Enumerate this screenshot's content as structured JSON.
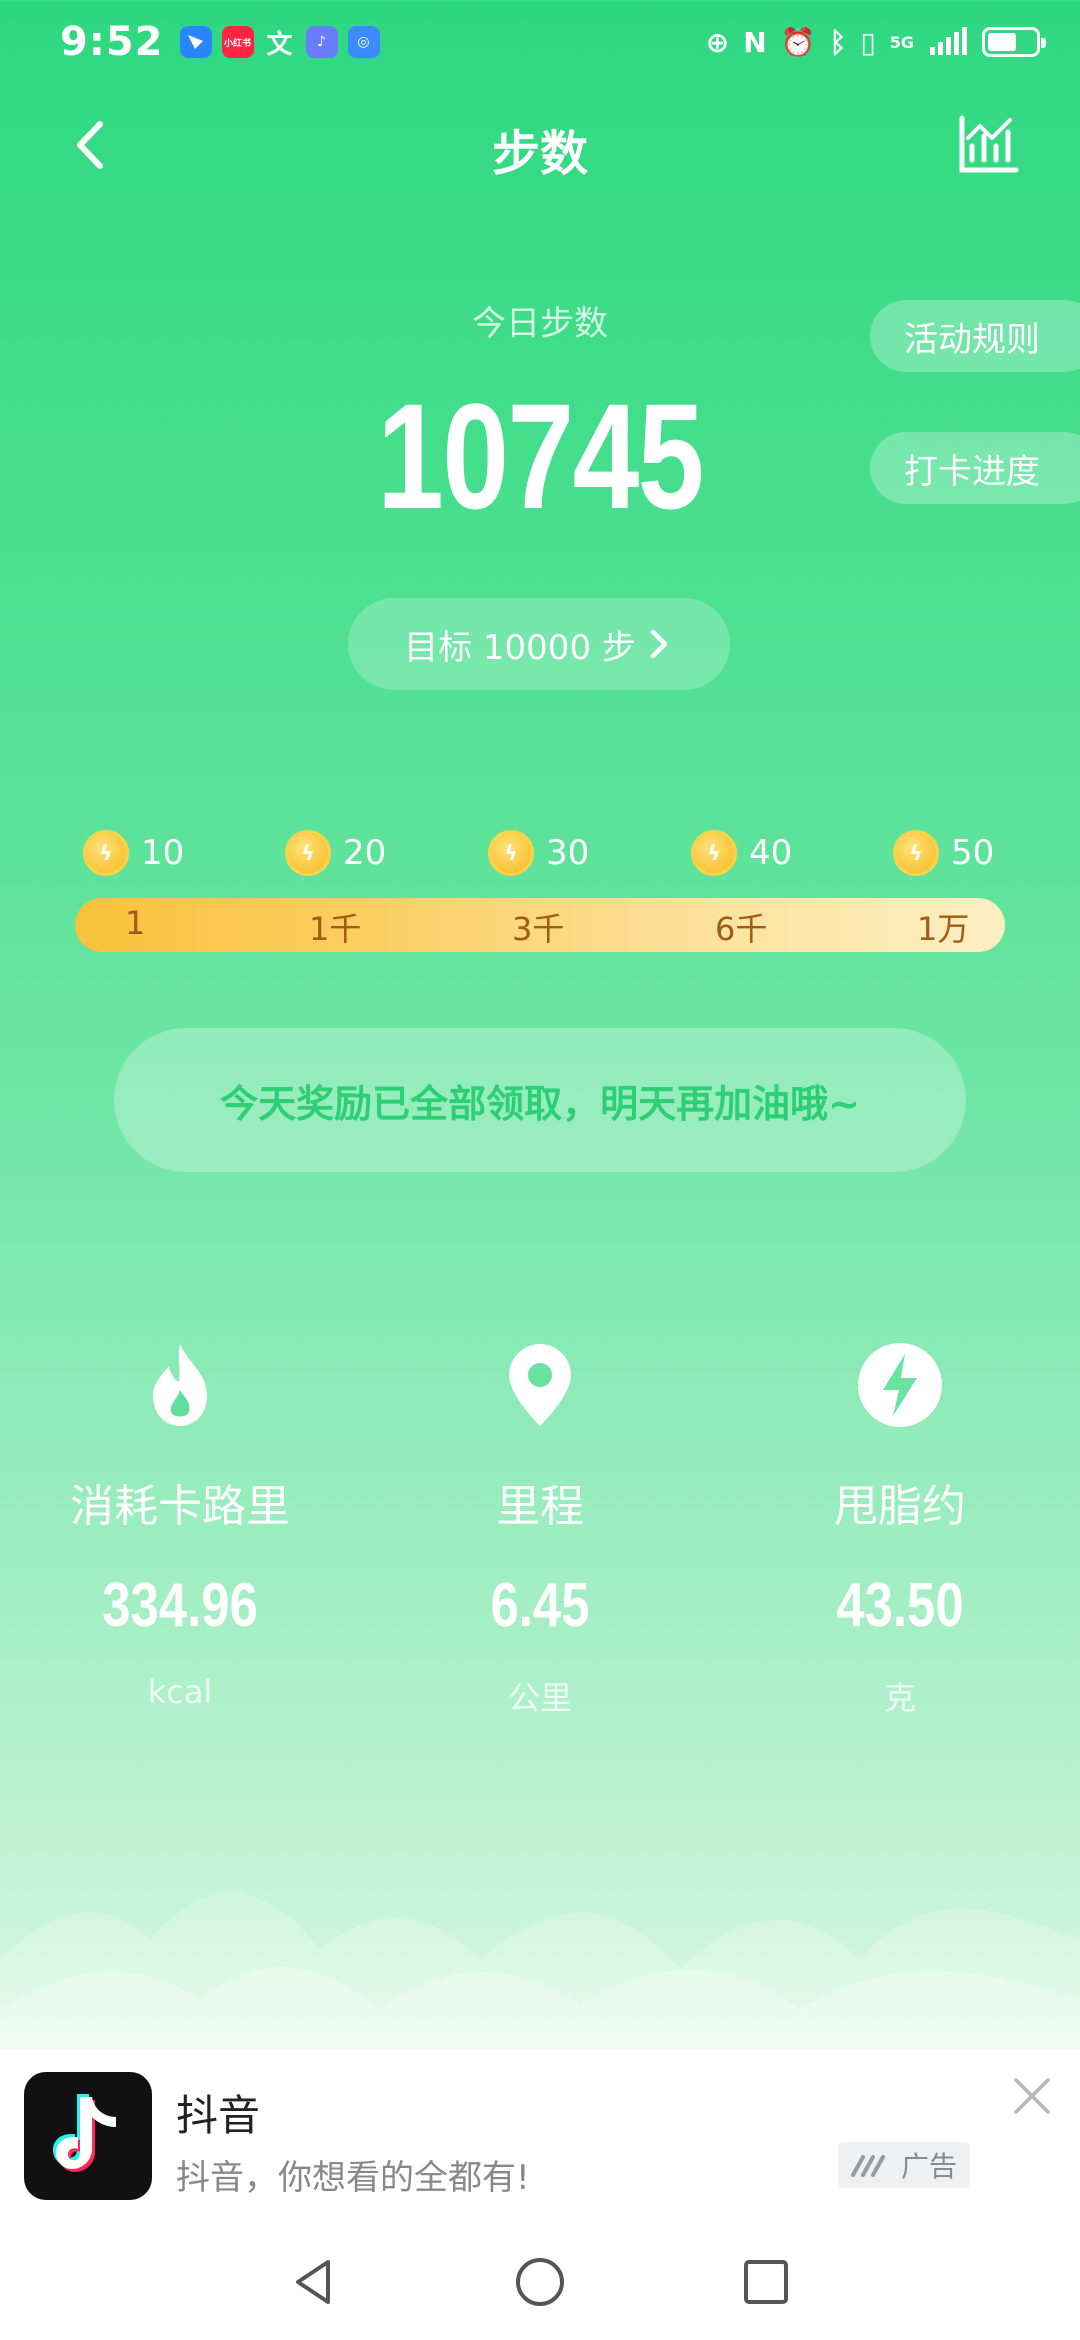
{
  "status_bar": {
    "time": "9:52",
    "apps": [
      {
        "name": "feishu-icon",
        "color": "#2a86ff"
      },
      {
        "name": "xiaohongshu-icon",
        "color": "#ff2442",
        "label": "小红书"
      },
      {
        "name": "translate-icon",
        "color": "transparent"
      },
      {
        "name": "music-icon",
        "color": "#6a7cff"
      },
      {
        "name": "browser-icon",
        "color": "#3a8bff"
      }
    ],
    "network": "5G"
  },
  "nav": {
    "title": "步数"
  },
  "today": {
    "label": "今日步数",
    "steps": "10745"
  },
  "side_buttons": {
    "rules": "活动规则",
    "checkin_progress": "打卡进度"
  },
  "goal": {
    "label": "目标 10000 步"
  },
  "rewards": {
    "coins": [
      {
        "amount": "10"
      },
      {
        "amount": "20"
      },
      {
        "amount": "30"
      },
      {
        "amount": "40"
      },
      {
        "amount": "50"
      }
    ],
    "milestones": [
      {
        "label": "1"
      },
      {
        "label": "1千"
      },
      {
        "label": "3千"
      },
      {
        "label": "6千"
      },
      {
        "label": "1万"
      }
    ]
  },
  "banner": {
    "text": "今天奖励已全部领取，明天再加油哦~"
  },
  "stats": [
    {
      "name": "消耗卡路里",
      "value": "334.96",
      "unit": "kcal",
      "icon": "flame-icon"
    },
    {
      "name": "里程",
      "value": "6.45",
      "unit": "公里",
      "icon": "location-pin-icon"
    },
    {
      "name": "甩脂约",
      "value": "43.50",
      "unit": "克",
      "icon": "lightning-icon"
    }
  ],
  "ad": {
    "title": "抖音",
    "subtitle": "抖音，你想看的全都有!",
    "tag": "广告"
  },
  "colors": {
    "accent_green": "#2dcf75",
    "coin_gold": "#f6b81c",
    "progress_text": "#a25a14"
  }
}
